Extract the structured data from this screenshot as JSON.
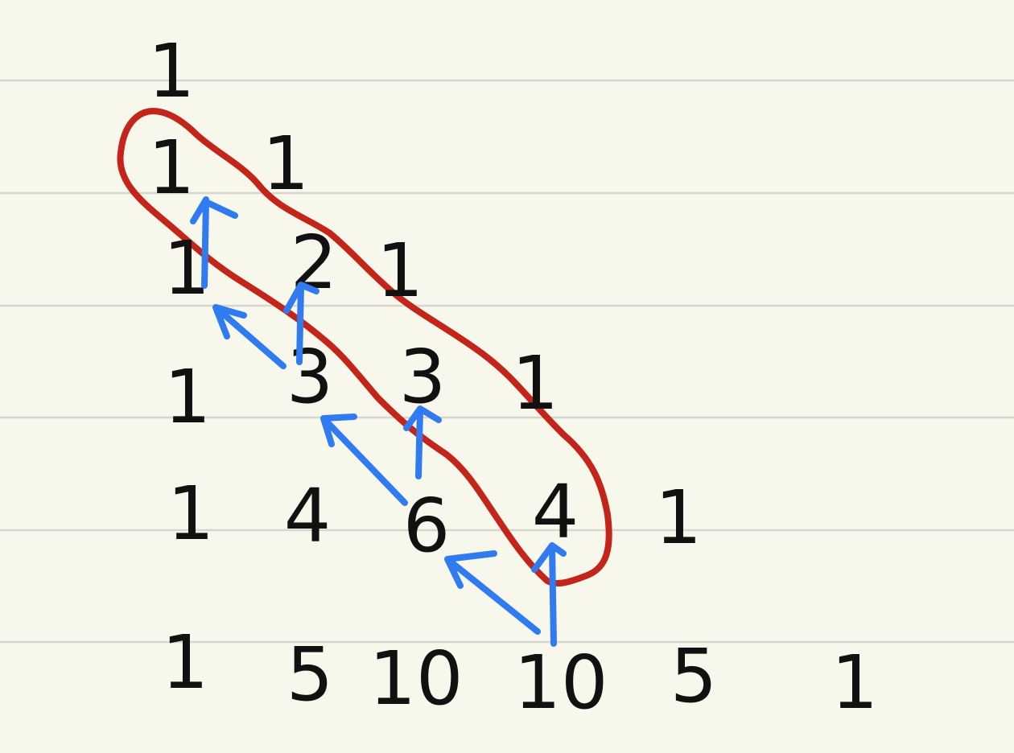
{
  "paper": {
    "background": "#f8f7ec",
    "rule_color": "#d6d6d0"
  },
  "colors": {
    "ink": "#111111",
    "highlight": "#c4251b",
    "arrow": "#2f7bef"
  },
  "triangle": {
    "rows": [
      [
        "1"
      ],
      [
        "1",
        "1"
      ],
      [
        "1",
        "2",
        "1"
      ],
      [
        "1",
        "3",
        "3",
        "1"
      ],
      [
        "1",
        "4",
        "6",
        "4",
        "1"
      ],
      [
        "1",
        "5",
        "10",
        "10",
        "5",
        "1"
      ]
    ]
  },
  "highlighted_diagonal": [
    "1",
    "2",
    "3",
    "4"
  ]
}
